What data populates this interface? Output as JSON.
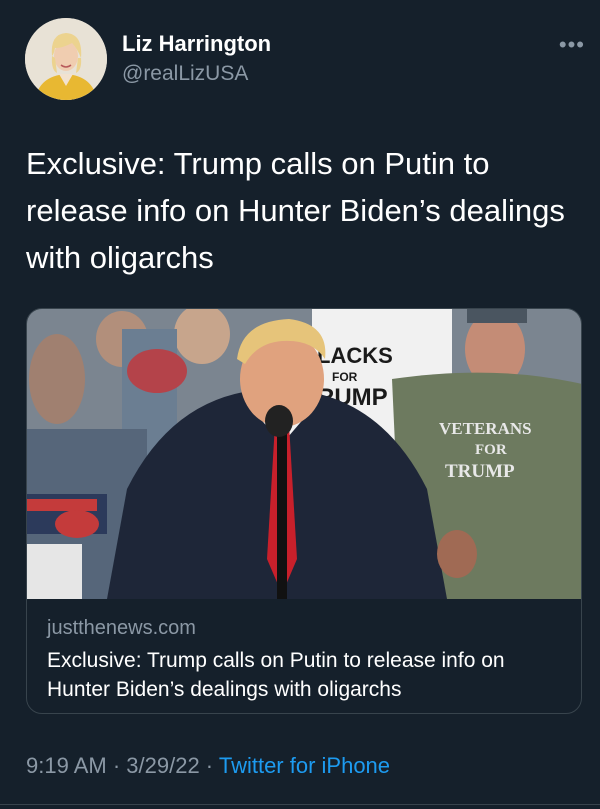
{
  "author": {
    "name": "Liz Harrington",
    "handle": "@realLizUSA"
  },
  "more_icon": "more-horizontal-icon",
  "tweet": {
    "text": "Exclusive: Trump calls on Putin to release info on Hunter Biden’s dealings with oligarchs"
  },
  "card": {
    "domain": "justthenews.com",
    "title": "Exclusive: Trump calls on Putin to release info on Hunter Biden’s dealings with oligarchs",
    "image_signs": {
      "sign1_line1": "LACKS",
      "sign1_line2": "FOR",
      "sign1_line3": "RUMP",
      "shirt_line1": "VETERANS",
      "shirt_line2": "FOR",
      "shirt_line3": "TRUMP"
    }
  },
  "meta": {
    "time": "9:19 AM",
    "separator": " · ",
    "date": "3/29/22",
    "source": "Twitter for iPhone"
  },
  "colors": {
    "background": "#15202b",
    "link": "#1d9bf0",
    "secondary_text": "#8b98a5"
  }
}
